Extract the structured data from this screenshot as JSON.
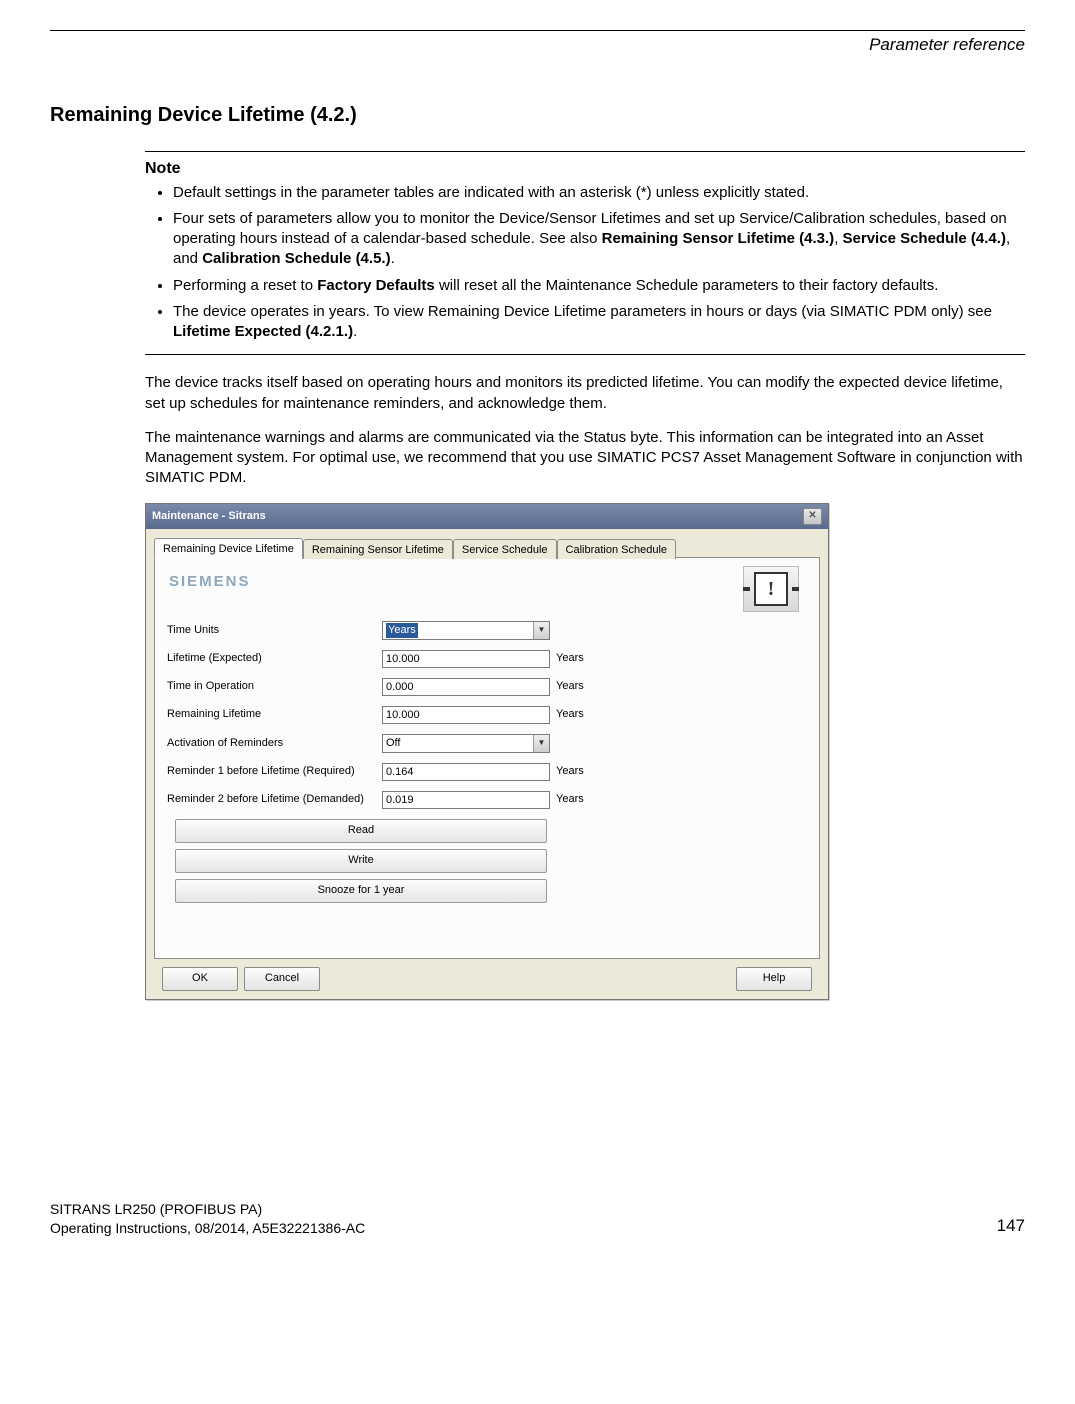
{
  "header": {
    "chapter": "Parameter reference"
  },
  "section_heading": "Remaining Device Lifetime (4.2.)",
  "note": {
    "title": "Note",
    "items": [
      {
        "pre": "Default settings in the parameter tables are indicated with an asterisk (*) unless explicitly stated."
      },
      {
        "pre": "Four sets of parameters allow you to monitor the Device/Sensor Lifetimes and set up Service/Calibration schedules, based on operating hours instead of a calendar-based schedule. See also ",
        "b1": "Remaining Sensor Lifetime (4.3.)",
        "m1": ", ",
        "b2": "Service Schedule (4.4.)",
        "m2": ", and ",
        "b3": "Calibration Schedule (4.5.)",
        "post": "."
      },
      {
        "pre": "Performing a reset to ",
        "b1": "Factory Defaults",
        "post": " will reset all the Maintenance Schedule parameters to their factory defaults."
      },
      {
        "pre": "The device operates in years. To view Remaining Device Lifetime parameters in hours or days (via SIMATIC PDM only) see ",
        "b1": "Lifetime Expected (4.2.1.)",
        "post": "."
      }
    ]
  },
  "paragraphs": [
    "The device tracks itself based on operating hours and monitors its predicted lifetime. You can modify the expected device lifetime, set up schedules for maintenance reminders, and acknowledge them.",
    "The maintenance warnings and alarms are communicated via the Status byte. This information can be integrated into an Asset Management system. For optimal use, we recommend that you use SIMATIC PCS7 Asset Management Software in conjunction with SIMATIC PDM."
  ],
  "dialog": {
    "title": "Maintenance - Sitrans",
    "close": "✕",
    "tabs": [
      "Remaining Device Lifetime",
      "Remaining Sensor Lifetime",
      "Service Schedule",
      "Calibration Schedule"
    ],
    "active_tab": 0,
    "logo": "SIEMENS",
    "status_glyph": "!",
    "fields": {
      "time_units": {
        "label": "Time Units",
        "value": "Years",
        "type": "select_hl"
      },
      "lifetime_expected": {
        "label": "Lifetime (Expected)",
        "value": "10.000",
        "unit": "Years",
        "type": "input"
      },
      "time_in_operation": {
        "label": "Time in Operation",
        "value": "0.000",
        "unit": "Years",
        "type": "input"
      },
      "remaining_lifetime": {
        "label": "Remaining Lifetime",
        "value": "10.000",
        "unit": "Years",
        "type": "input"
      },
      "activation": {
        "label": "Activation of Reminders",
        "value": "Off",
        "type": "select"
      },
      "rem1": {
        "label": "Reminder 1 before Lifetime (Required)",
        "value": "0.164",
        "unit": "Years",
        "type": "input"
      },
      "rem2": {
        "label": "Reminder 2 before Lifetime (Demanded)",
        "value": "0.019",
        "unit": "Years",
        "type": "input"
      }
    },
    "buttons": {
      "read": "Read",
      "write": "Write",
      "snooze": "Snooze for 1 year"
    },
    "bottom": {
      "ok": "OK",
      "cancel": "Cancel",
      "help": "Help"
    }
  },
  "footer": {
    "line1": "SITRANS LR250 (PROFIBUS PA)",
    "line2": "Operating Instructions, 08/2014, A5E32221386-AC",
    "page": "147"
  }
}
